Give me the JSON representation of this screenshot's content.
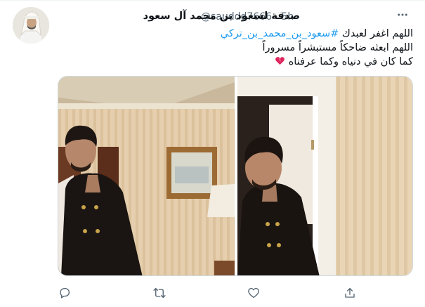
{
  "tweet": {
    "display_name": "صدقة لسعود بن محمد آل سعود",
    "handle": "@sauddd7666",
    "separator": "·",
    "time": "5h",
    "more_icon": "more-options-icon",
    "lines": {
      "line1_prefix": "اللهم اغفر لعبدك",
      "hashtag": "#سعود_بن_محمد_بن_تركي",
      "line2": "اللهم ابعثه ضاحكاً مستبشراً مسروراً",
      "line3": "كما كان في دنياه وكما عرفناه"
    },
    "emoji": "broken-heart-icon",
    "media": {
      "count": 2,
      "items": [
        "photo-left",
        "photo-right"
      ]
    },
    "actions": [
      "reply-icon",
      "retweet-icon",
      "like-icon",
      "share-icon"
    ],
    "colors": {
      "accent": "#1d9bf0",
      "text": "#0f1419",
      "muted": "#536471",
      "heart": "#e0245e"
    }
  }
}
